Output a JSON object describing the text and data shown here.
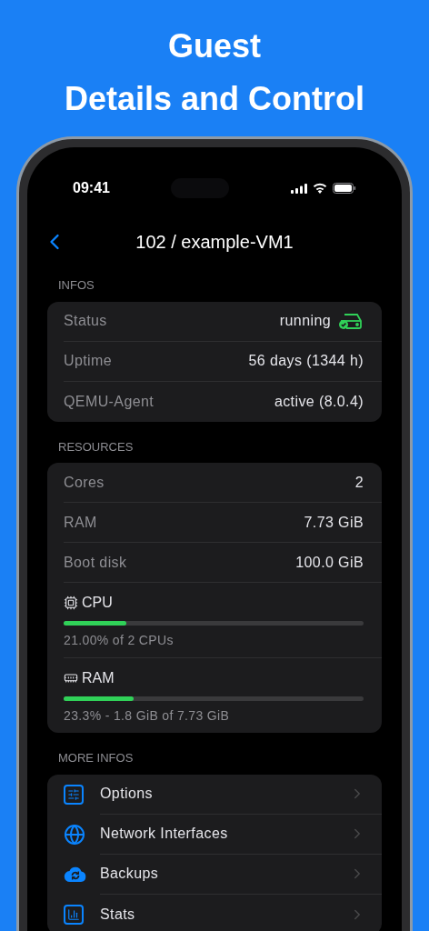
{
  "headline": [
    "Guest",
    "Details and Control"
  ],
  "status_bar": {
    "time": "09:41"
  },
  "nav": {
    "title": "102 / example-VM1"
  },
  "sections": [
    {
      "header": "INFOS",
      "rows": [
        {
          "kind": "status",
          "label": "Status",
          "value": "running"
        },
        {
          "kind": "value",
          "label": "Uptime",
          "value": "56 days (1344 h)"
        },
        {
          "kind": "value",
          "label": "QEMU-Agent",
          "value": "active (8.0.4)"
        }
      ]
    },
    {
      "header": "RESOURCES",
      "rows": [
        {
          "kind": "value",
          "label": "Cores",
          "value": "2"
        },
        {
          "kind": "value",
          "label": "RAM",
          "value": "7.73 GiB"
        },
        {
          "kind": "value",
          "label": "Boot disk",
          "value": "100.0 GiB"
        },
        {
          "kind": "meter",
          "label": "CPU",
          "level": 0.21,
          "reading": "21.00% of 2 CPUs"
        },
        {
          "kind": "meter",
          "label": "RAM",
          "level": 0.233,
          "reading": "23.3% - 1.8 GiB of 7.73 GiB"
        }
      ]
    },
    {
      "header": "MORE INFOS",
      "rows": [
        {
          "kind": "link",
          "label": "Options"
        },
        {
          "kind": "link",
          "label": "Network Interfaces"
        },
        {
          "kind": "link",
          "label": "Backups"
        },
        {
          "kind": "link",
          "label": "Stats"
        }
      ]
    }
  ]
}
